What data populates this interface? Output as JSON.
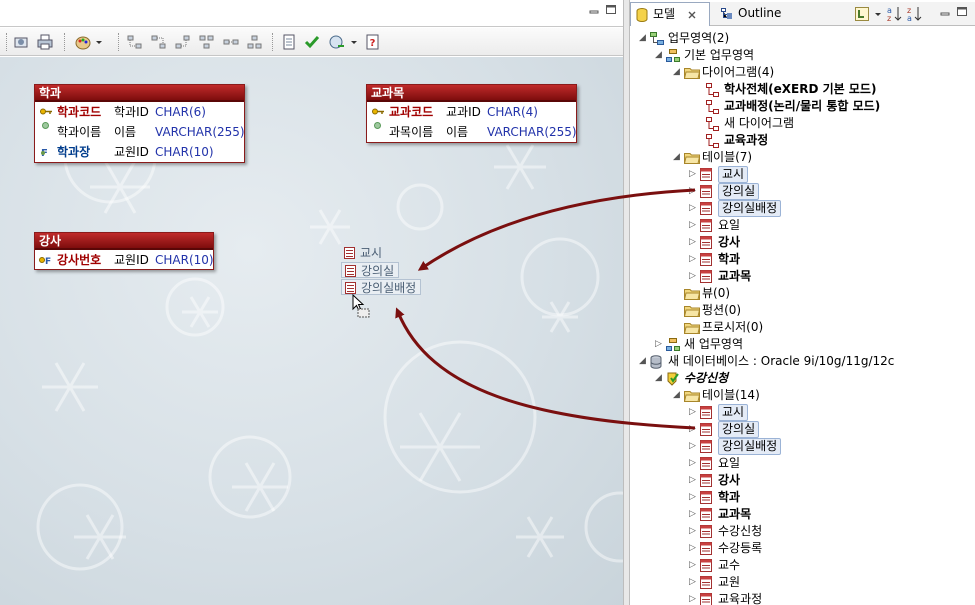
{
  "editor": {
    "entities": [
      {
        "title": "학과",
        "rows": [
          {
            "kind": "pk",
            "logical": "학과코드",
            "physical": "학과ID",
            "type": "CHAR(6)"
          },
          {
            "kind": "attr",
            "logical": "학과이름",
            "physical": "이름",
            "type": "VARCHAR(255)"
          },
          {
            "kind": "fk",
            "logical": "학과장",
            "physical": "교원ID",
            "type": "CHAR(10)"
          }
        ]
      },
      {
        "title": "교과목",
        "rows": [
          {
            "kind": "pk",
            "logical": "교과코드",
            "physical": "교과ID",
            "type": "CHAR(4)"
          },
          {
            "kind": "attr",
            "logical": "과목이름",
            "physical": "이름",
            "type": "VARCHAR(255)"
          }
        ]
      },
      {
        "title": "강사",
        "rows": [
          {
            "kind": "pkfk",
            "logical": "강사번호",
            "physical": "교원ID",
            "type": "CHAR(10)"
          }
        ]
      }
    ],
    "drag_items": [
      "교시",
      "강의실",
      "강의실배정"
    ]
  },
  "panel": {
    "tabs": [
      {
        "label": "모델",
        "icon": "model-icon"
      },
      {
        "label": "Outline",
        "icon": "outline-icon"
      }
    ],
    "tree": [
      {
        "label": "업무영역(2)",
        "icon": "subject-areas-icon"
      },
      {
        "label": "기본 업무영역",
        "icon": "subject-area-icon"
      },
      {
        "label": "다이어그램(4)",
        "icon": "folder-icon"
      },
      {
        "label": "학사전체(eXERD 기본 모드)",
        "icon": "diagram-icon"
      },
      {
        "label": "교과배정(논리/물리 통합 모드)",
        "icon": "diagram-icon"
      },
      {
        "label": "새 다이어그램",
        "icon": "diagram-icon"
      },
      {
        "label": "교육과정",
        "icon": "diagram-icon"
      },
      {
        "label": "테이블(7)",
        "icon": "folder-icon"
      },
      {
        "label": "교시",
        "icon": "table-icon"
      },
      {
        "label": "강의실",
        "icon": "table-icon"
      },
      {
        "label": "강의실배정",
        "icon": "table-icon"
      },
      {
        "label": "요일",
        "icon": "table-icon"
      },
      {
        "label": "강사",
        "icon": "table-icon"
      },
      {
        "label": "학과",
        "icon": "table-icon"
      },
      {
        "label": "교과목",
        "icon": "table-icon"
      },
      {
        "label": "뷰(0)",
        "icon": "folder-icon"
      },
      {
        "label": "펑션(0)",
        "icon": "folder-icon"
      },
      {
        "label": "프로시저(0)",
        "icon": "folder-icon"
      },
      {
        "label": "새 업무영역",
        "icon": "subject-area-icon"
      },
      {
        "label": "새 데이터베이스 : Oracle 9i/10g/11g/12c",
        "icon": "database-icon"
      },
      {
        "label": "수강신청",
        "icon": "schema-icon"
      },
      {
        "label": "테이블(14)",
        "icon": "folder-icon"
      },
      {
        "label": "교시",
        "icon": "table-icon"
      },
      {
        "label": "강의실",
        "icon": "table-icon"
      },
      {
        "label": "강의실배정",
        "icon": "table-icon"
      },
      {
        "label": "요일",
        "icon": "table-icon"
      },
      {
        "label": "강사",
        "icon": "table-icon"
      },
      {
        "label": "학과",
        "icon": "table-icon"
      },
      {
        "label": "교과목",
        "icon": "table-icon"
      },
      {
        "label": "수강신청",
        "icon": "table-icon"
      },
      {
        "label": "수강등록",
        "icon": "table-icon"
      },
      {
        "label": "교수",
        "icon": "table-icon"
      },
      {
        "label": "교원",
        "icon": "table-icon"
      },
      {
        "label": "교육과정",
        "icon": "table-icon"
      }
    ]
  },
  "colors": {
    "entity_header": "#9a1616",
    "arrow": "#7a0f0f",
    "selection": "#e4ebf6"
  }
}
